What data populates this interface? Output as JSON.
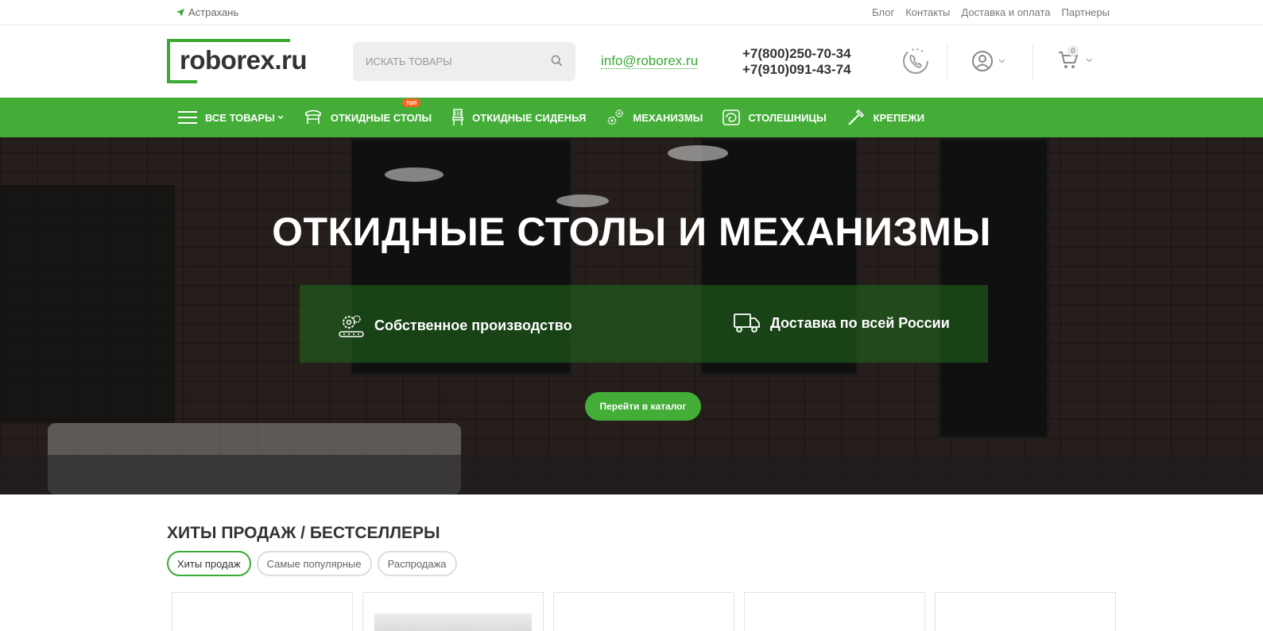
{
  "topbar": {
    "city": "Астрахань",
    "links": [
      "Блог",
      "Контакты",
      "Доставка и оплата",
      "Партнеры"
    ]
  },
  "header": {
    "logo_text": "roborex",
    "logo_dot": ".",
    "logo_ru": "ru",
    "search_placeholder": "ИСКАТЬ ТОВАРЫ",
    "email": "info@roborex.ru",
    "phones": [
      "+7(800)250-70-34",
      "+7(910)091-43-74"
    ],
    "cart_count": "0"
  },
  "nav": {
    "items": [
      {
        "label": "ВСЕ ТОВАРЫ",
        "icon": "hamburger-icon"
      },
      {
        "label": "ОТКИДНЫЕ СТОЛЫ",
        "icon": "table-icon",
        "badge": "топ"
      },
      {
        "label": "ОТКИДНЫЕ СИДЕНЬЯ",
        "icon": "seat-icon"
      },
      {
        "label": "МЕХАНИЗМЫ",
        "icon": "gears-icon"
      },
      {
        "label": "СТОЛЕШНИЦЫ",
        "icon": "tabletop-icon"
      },
      {
        "label": "КРЕПЕЖИ",
        "icon": "screw-icon"
      }
    ]
  },
  "hero": {
    "title": "ОТКИДНЫЕ СТОЛЫ И МЕХАНИЗМЫ",
    "features": [
      {
        "label": "Собственное производство",
        "icon": "factory-icon"
      },
      {
        "label": "Доставка по всей России",
        "icon": "truck-icon"
      }
    ],
    "cta_label": "Перейти в каталог"
  },
  "bestsellers": {
    "title": "ХИТЫ ПРОДАЖ / БЕСТСЕЛЛЕРЫ",
    "tabs": [
      "Хиты продаж",
      "Самые популярные",
      "Распродажа"
    ],
    "active_tab": "Хиты продаж"
  },
  "colors": {
    "accent": "#43ad38",
    "badge": "#f26522"
  }
}
